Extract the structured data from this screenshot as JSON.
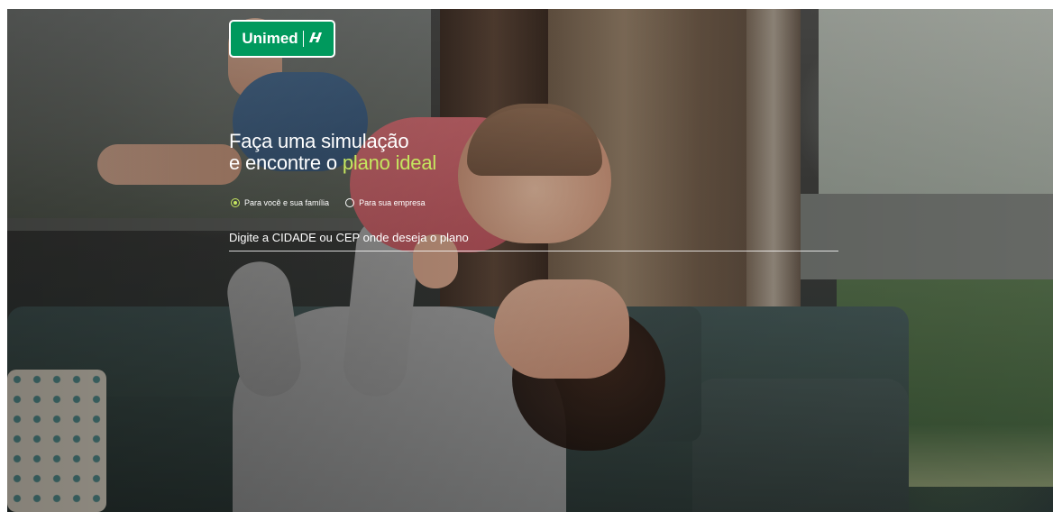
{
  "brand": {
    "name": "Unimed",
    "color": "#00995d",
    "icon": "unimed-logo-icon"
  },
  "hero": {
    "headline_line1": "Faça uma simulação",
    "headline_line2_prefix": "e encontre o",
    "headline_line2_accent": "plano ideal",
    "accent_color": "#c5e65f"
  },
  "plan_type": {
    "selected": "Para você e sua família",
    "options": [
      {
        "label": "Para você e sua família",
        "checked": true
      },
      {
        "label": "Para sua empresa",
        "checked": false
      }
    ]
  },
  "search": {
    "placeholder": "Digite a CIDADE ou CEP onde deseja o plano",
    "value": ""
  }
}
